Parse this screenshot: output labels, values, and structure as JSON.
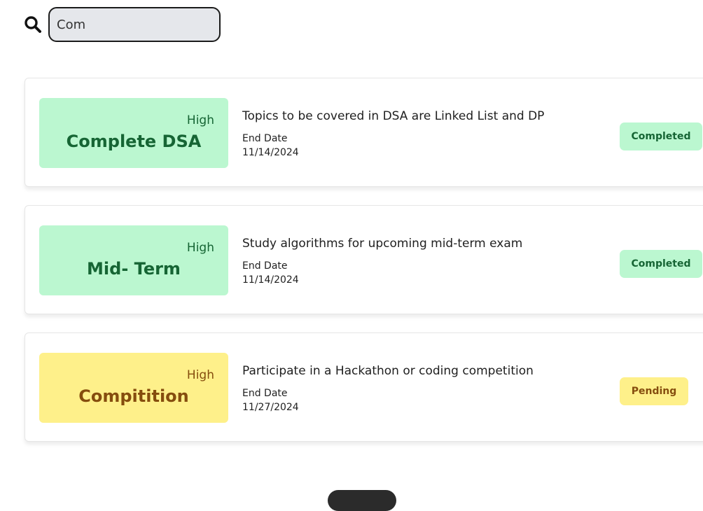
{
  "search": {
    "icon": "search-icon",
    "value": "Com"
  },
  "tasks": [
    {
      "priority": "High",
      "title": "Complete DSA",
      "description": "Topics to be covered in DSA are Linked List and DP",
      "end_label": "End Date",
      "end_date": "11/14/2024",
      "status": "Completed",
      "color": "#bbf7d0"
    },
    {
      "priority": "High",
      "title": "Mid- Term",
      "description": "Study algorithms for upcoming mid-term exam",
      "end_label": "End Date",
      "end_date": "11/14/2024",
      "status": "Completed",
      "color": "#bbf7d0"
    },
    {
      "priority": "High",
      "title": "Compitition",
      "description": "Participate in a Hackathon or coding competition",
      "end_label": "End Date",
      "end_date": "11/27/2024",
      "status": "Pending",
      "color": "#fef08a"
    }
  ]
}
